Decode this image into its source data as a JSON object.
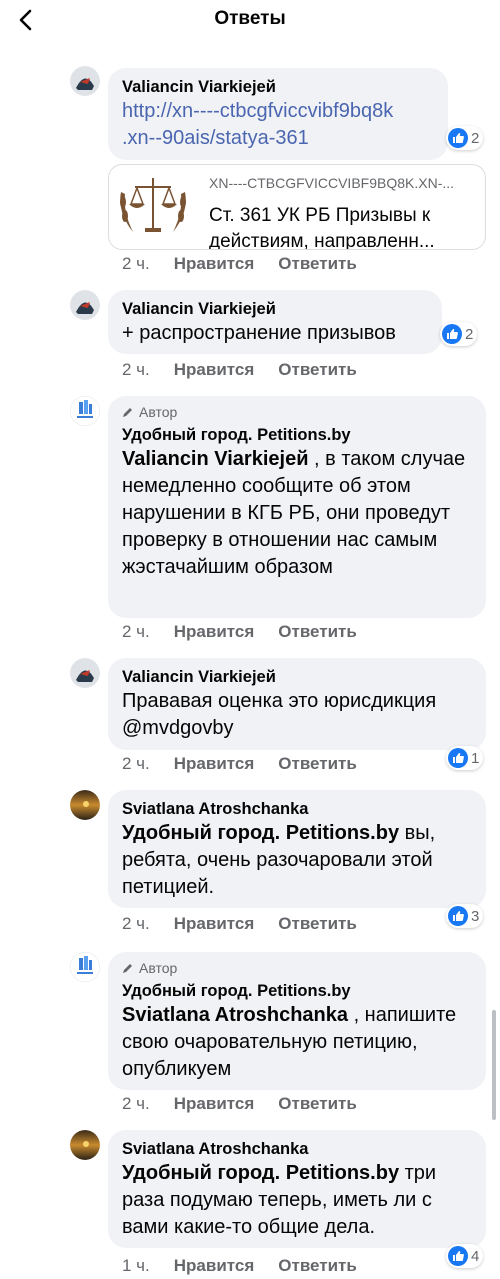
{
  "header": {
    "title": "Ответы"
  },
  "common": {
    "like_label": "Нравится",
    "reply_label": "Ответить",
    "author_badge": "Автор"
  },
  "comments": [
    {
      "name": "Valiancin Viarkiejeй",
      "link": "http://xn----ctbcgfviccvibf9bq8k.xn--90ais/statya-361",
      "link_line1": "http://xn----ctbcgfviccvibf9bq8k",
      "link_line2": ".xn--90ais/statya-361",
      "preview_domain": "XN----CTBCGFVICCVIBF9BQ8K.XN-...",
      "preview_title": "Ст. 361 УК РБ Призывы к действиям, направленн...",
      "time": "2 ч.",
      "likes": "2"
    },
    {
      "name": "Valiancin Viarkiejeй",
      "text": "+ распространение призывов",
      "time": "2 ч.",
      "likes": "2"
    },
    {
      "name": "Удобный город. Petitions.by",
      "mention": "Valiancin Viarkiejeй",
      "text": " , в таком случае немедленно сообщите об этом нарушении в КГБ РБ, они проведут проверку в отношении нас самым жэстачайшим образом",
      "time": "2 ч."
    },
    {
      "name": "Valiancin Viarkiejeй",
      "text": "Прававая оценка это юрисдикция @mvdgovby",
      "time": "2 ч.",
      "likes": "1"
    },
    {
      "name": "Sviatlana Atroshchanka",
      "mention": "Удобный город. Petitions.by",
      "text": " вы, ребята, очень разочаровали этой петицией.",
      "time": "2 ч.",
      "likes": "3"
    },
    {
      "name": "Удобный город. Petitions.by",
      "mention": "Sviatlana Atroshchanka",
      "text": " , напишите свою очаровательную петицию, опубликуем",
      "time": "2 ч."
    },
    {
      "name": "Sviatlana Atroshchanka",
      "mention": "Удобный город. Petitions.by",
      "text": " три раза подумаю теперь, иметь ли с вами какие-то общие дела.",
      "time": "1 ч.",
      "likes": "4"
    }
  ]
}
